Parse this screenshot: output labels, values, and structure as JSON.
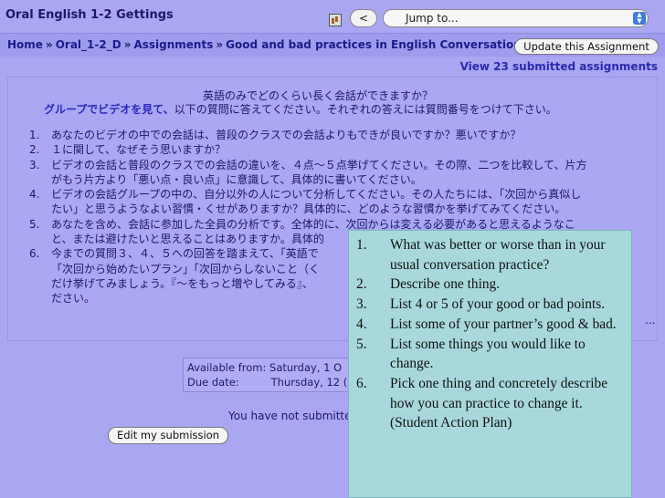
{
  "header": {
    "site_title": "Oral English 1-2 Gettings",
    "back_label": "<",
    "jump_to": "Jump to..."
  },
  "breadcrumb": {
    "items": [
      "Home",
      "Oral_1-2_D",
      "Assignments",
      "Good and bad practices in English Conversation"
    ],
    "separator": "»"
  },
  "update_button": "Update this Assignment",
  "view_submitted": "View 23 submitted assignments",
  "assignment": {
    "title_jp": "英語のみでどのくらい長く会話ができますか？",
    "intro_highlight": "グループでビデオを見て、",
    "intro_rest": "以下の質問に答えてください。それぞれの答えには質問番号をつけて下さい。",
    "questions": [
      {
        "num": "1.",
        "lines": [
          "あなたのビデオの中での会話は、普段のクラスでの会話よりもできが良いですか？悪いですか？"
        ]
      },
      {
        "num": "2.",
        "lines": [
          "１に関して、なぜそう思いますか？"
        ]
      },
      {
        "num": "3.",
        "lines": [
          "ビデオの会話と普段のクラスでの会話の違いを、４点〜５点挙げてください。その際、二つを比較して、片方",
          "がもう片方より「悪い点・良い点」に意識して、具体的に書いてください。"
        ]
      },
      {
        "num": "4.",
        "lines": [
          "ビデオの会話グループの中の、自分以外の人について分析してください。その人たちには、「次回から真似し",
          "たい」と思うようなよい習慣・くせがありますか？具体的に、どのような習慣かを挙げてみてください。"
        ]
      },
      {
        "num": "5.",
        "lines": [
          "あなたを含め、会話に参加した全員の分析です。全体的に、次回からは変える必要があると思えるようなこ",
          "と、または避けたいと思えることはありますか。具体的"
        ]
      },
      {
        "num": "6.",
        "lines": [
          "今までの質問３、４、５への回答を踏まえて、「英語で",
          "「次回から始めたいプラン」「次回からしないこと（く",
          "だけ挙げてみましょう。『〜をもっと増やしてみる』、",
          "ださい。"
        ]
      }
    ],
    "ellipsis": "..."
  },
  "dates": {
    "available_label": "Available from:",
    "available_value": "Saturday, 1 O",
    "due_label": "Due date:",
    "due_value": "Thursday, 12 ("
  },
  "not_submitted": "You have not submitte",
  "edit_button": "Edit my submission",
  "overlay": {
    "items": [
      {
        "num": "1.",
        "text": "What was better or worse than in your usual conversation practice?"
      },
      {
        "num": "2.",
        "text": "Describe one thing."
      },
      {
        "num": "3.",
        "text": "List 4 or 5 of your good or bad points."
      },
      {
        "num": "4.",
        "text": "List some of your partner’s good & bad."
      },
      {
        "num": "5.",
        "text": "List some things you would like to change."
      },
      {
        "num": "6.",
        "text": "Pick one thing and concretely describe how you can practice to change it. (Student Action Plan)"
      }
    ]
  }
}
